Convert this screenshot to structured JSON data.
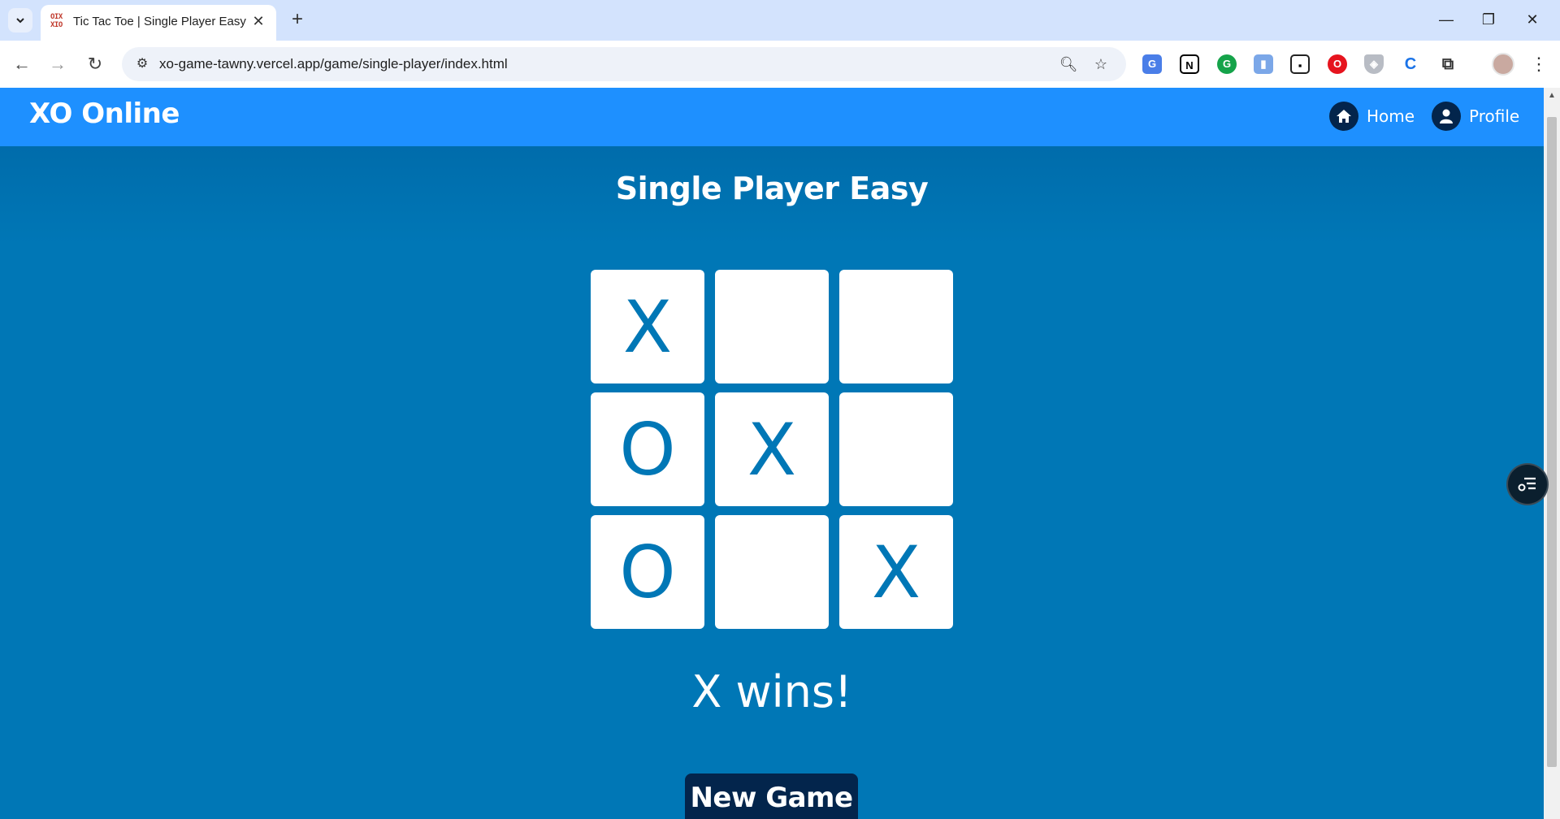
{
  "browser": {
    "tab_title": "Tic Tac Toe | Single Player Easy",
    "tab_favicon": "OIX XIO",
    "url": "xo-game-tawny.vercel.app/game/single-player/index.html",
    "icons": {
      "tab_search": "chevron-down-icon",
      "close_tab": "close-icon",
      "new_tab": "plus-icon",
      "back": "arrow-left-icon",
      "forward": "arrow-right-icon",
      "reload": "reload-icon",
      "site_info": "tune-icon",
      "zoom": "zoom-icon",
      "bookmark": "star-icon",
      "extensions": [
        "translate-icon",
        "notion-icon",
        "grammarly-icon",
        "clipboard-icon",
        "picture-in-picture-icon",
        "opera-icon",
        "shield-icon",
        "c-extension-icon",
        "puzzle-icon"
      ]
    }
  },
  "header": {
    "logo": "XO Online",
    "nav": [
      {
        "label": "Home",
        "icon": "home-icon"
      },
      {
        "label": "Profile",
        "icon": "user-icon"
      }
    ],
    "colors": {
      "bar": "#1e90ff",
      "icon_bg": "#03254c"
    }
  },
  "game": {
    "title": "Single Player Easy",
    "board": [
      "X",
      "",
      "",
      "O",
      "X",
      "",
      "O",
      "",
      "X"
    ],
    "status": "X wins!",
    "new_game_label": "New Game",
    "colors": {
      "page_bg": "#0077b6",
      "mark": "#0077b6",
      "cell": "#ffffff",
      "button": "#03254c"
    }
  }
}
